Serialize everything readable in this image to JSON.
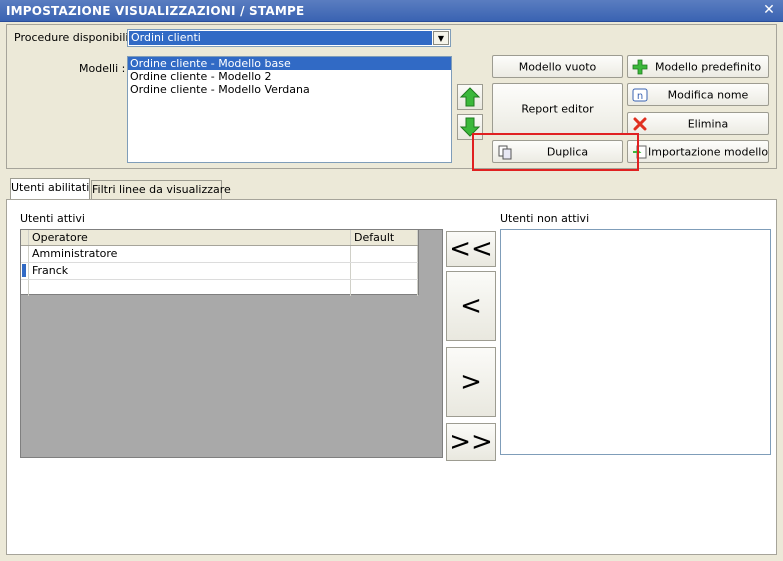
{
  "window": {
    "title": "IMPOSTAZIONE VISUALIZZAZIONI / STAMPE",
    "close_glyph": "✕"
  },
  "procedures": {
    "label": "Procedure disponibili :",
    "selected": "Ordini clienti"
  },
  "models": {
    "label": "Modelli :",
    "items": [
      {
        "label": "Ordine cliente - Modello base",
        "selected": true
      },
      {
        "label": "Ordine cliente - Modello 2",
        "selected": false
      },
      {
        "label": "Ordine cliente - Modello Verdana",
        "selected": false
      }
    ]
  },
  "buttons": {
    "modello_vuoto": "Modello vuoto",
    "report_editor": "Report editor",
    "duplica": "Duplica",
    "modello_predefinito": "Modello predefinito",
    "modifica_nome": "Modifica nome",
    "elimina": "Elimina",
    "importazione_modello": "Importazione modello"
  },
  "tabs": [
    {
      "label": "Utenti abilitati",
      "active": true
    },
    {
      "label": "Filtri linee da visualizzare",
      "active": false
    }
  ],
  "active_users": {
    "label": "Utenti attivi",
    "columns": [
      "Operatore",
      "Default"
    ],
    "rows": [
      {
        "operator": "Amministratore",
        "default": ""
      },
      {
        "operator": "Franck",
        "default": ""
      }
    ]
  },
  "inactive_users": {
    "label": "Utenti non attivi"
  },
  "move_buttons": {
    "all_left": "<<",
    "left": "<",
    "right": ">",
    "all_right": ">>"
  },
  "colors": {
    "selection": "#316ac5",
    "title_bar": "#3a63b2",
    "highlight": "#e02020",
    "icon_green": "#3bb83b",
    "icon_red": "#e03020"
  },
  "icons": {
    "up": "green-up-arrow-icon",
    "down": "green-down-arrow-icon",
    "duplica": "copy-icon",
    "modello_predefinito": "green-plus-icon",
    "modifica_nome": "rename-icon",
    "elimina": "red-x-icon",
    "importazione_modello": "import-icon"
  }
}
